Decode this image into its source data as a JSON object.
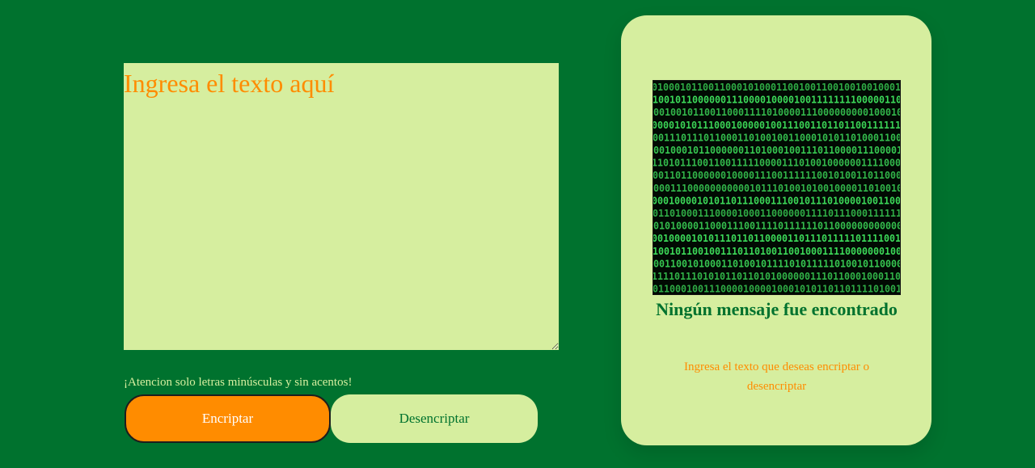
{
  "input": {
    "placeholder": "Ingresa el texto aquí",
    "value": ""
  },
  "warning": "¡Atencion solo letras minúsculas y sin acentos!",
  "buttons": {
    "encrypt_label": "Encriptar",
    "decrypt_label": "Desencriptar"
  },
  "output": {
    "image_icon": "binary-code-matrix-icon",
    "title": "Ningún mensaje fue encontrado",
    "message": "Ingresa el texto que deseas encriptar o desencriptar"
  },
  "colors": {
    "background": "#00722e",
    "panel": "#d6ee9f",
    "accent": "#ff8c00",
    "matrix_green": "#3ddc5a"
  }
}
